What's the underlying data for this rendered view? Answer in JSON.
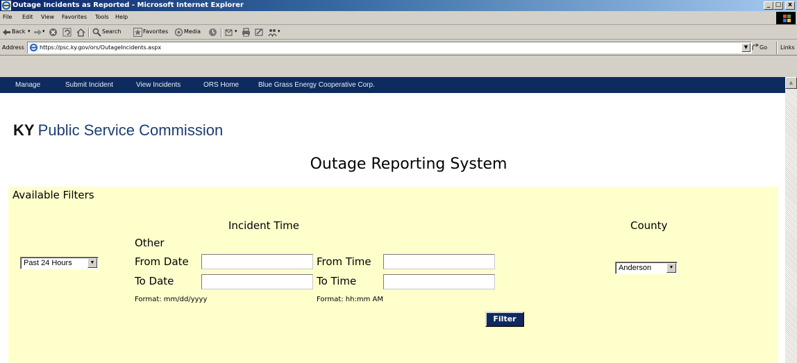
{
  "window": {
    "title": "Outage Incidents as Reported - Microsoft Internet Explorer",
    "controls": [
      "_",
      "□",
      "x"
    ]
  },
  "menu": {
    "items": [
      {
        "label": "File"
      },
      {
        "label": "Edit"
      },
      {
        "label": "View"
      },
      {
        "label": "Favorites"
      },
      {
        "label": "Tools"
      },
      {
        "label": "Help"
      }
    ]
  },
  "toolbar": {
    "back_label": "Back",
    "search_label": "Search",
    "favorites_label": "Favorites",
    "media_label": "Media"
  },
  "address_bar": {
    "label": "Address",
    "url": "https://psc.ky.gov/ors/OutageIncidents.aspx",
    "go_label": "Go",
    "links_label": "Links"
  },
  "site_nav": {
    "items": [
      {
        "label": "Manage"
      },
      {
        "label": "Submit Incident"
      },
      {
        "label": "View Incidents"
      },
      {
        "label": "ORS Home"
      },
      {
        "label": "Blue Grass Energy Cooperative Corp."
      }
    ]
  },
  "brand": {
    "state": "KY",
    "agency": "Public Service Commission"
  },
  "page": {
    "title": "Outage Reporting System"
  },
  "filters": {
    "heading": "Available Filters",
    "incident_time_heading": "Incident Time",
    "county_heading": "County",
    "period_selected": "Past 24 Hours",
    "other_label": "Other",
    "from_date_label": "From Date",
    "to_date_label": "To Date",
    "from_time_label": "From Time",
    "to_time_label": "To Time",
    "from_date_value": "",
    "to_date_value": "",
    "from_time_value": "",
    "to_time_value": "",
    "date_format_hint": "Format: mm/dd/yyyy",
    "time_format_hint": "Format: hh:mm AM",
    "county_selected": "Anderson",
    "filter_button": "Filter"
  },
  "colors": {
    "nav_background": "#0d2b5e",
    "filter_panel": "#ffffcc",
    "brand_blue": "#1b3d73"
  }
}
